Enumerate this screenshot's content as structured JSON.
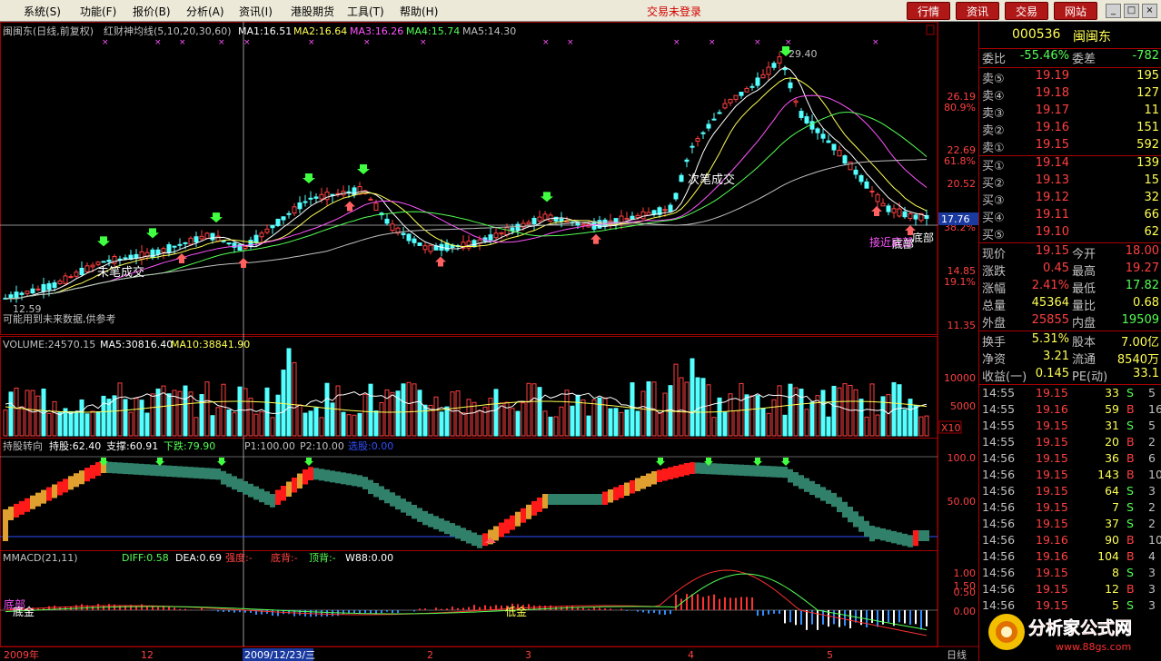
{
  "menu": [
    "系统(S)",
    "功能(F)",
    "报价(B)",
    "分析(A)",
    "资讯(I)",
    "港股期货",
    "工具(T)",
    "帮助(H)"
  ],
  "login_status": "交易未登录",
  "top_buttons": [
    "行情",
    "资讯",
    "交易",
    "网站"
  ],
  "window_buttons": [
    "_",
    "□",
    "×"
  ],
  "main_chart": {
    "title": "闽闽东(日线,前复权)",
    "indicator": "红财神均线(5,10,20,30,60)",
    "ma": [
      {
        "label": "MA1:16.51",
        "color": "#ffffff"
      },
      {
        "label": "MA2:16.64",
        "color": "#ffff54"
      },
      {
        "label": "MA3:16.26",
        "color": "#ff54ff"
      },
      {
        "label": "MA4:15.74",
        "color": "#54ff54"
      },
      {
        "label": "MA5:14.30",
        "color": "#c0c0c0"
      }
    ],
    "price_axis": [
      "26.19",
      "22.69",
      "20.52",
      "14.85",
      "11.35"
    ],
    "pct_axis": [
      "80.9%",
      "61.8%",
      "38.2%",
      "19.1%"
    ],
    "high_label": "29.40",
    "low_label": "12.59",
    "cursor_price": "17.76",
    "notes": [
      "未笔成交",
      "次笔成交",
      "可能用到未来数据,供参考",
      "接近底部",
      "底部",
      "底部"
    ]
  },
  "volume": {
    "title": "VOLUME:24570.15",
    "ma5": "MA5:30816.40",
    "ma10": "MA10:38841.90",
    "axis": [
      "10000",
      "5000"
    ],
    "unit": "X10"
  },
  "hold": {
    "title": "持股转向",
    "hold_val": "持股:62.40",
    "support": "支撑:60.91",
    "drop": "下跌:79.90",
    "p1": "P1:100.00",
    "p2": "P2:10.00",
    "sel": "选股:0.00",
    "axis": [
      "100.0",
      "50.00"
    ]
  },
  "macd": {
    "title": "MMACD(21,11)",
    "diff": "DIFF:0.58",
    "dea": "DEA:0.69",
    "strong": "强度:-",
    "bottom": "底背:-",
    "top": "顶背:-",
    "w88": "W88:0.00",
    "axis": [
      "1.50",
      "1.00",
      "0.50",
      "0.00"
    ],
    "tags": [
      "底部",
      "底金",
      "低金"
    ]
  },
  "date_axis": [
    "2009年",
    "12",
    "2009/12/23/三",
    "2",
    "3",
    "4",
    "5"
  ],
  "period": "日线",
  "stock": {
    "code": "000536",
    "name": "闽闽东"
  },
  "ratio": {
    "label1": "委比",
    "val1": "-55.46%",
    "label2": "委差",
    "val2": "-782"
  },
  "sells": [
    {
      "label": "卖⑤",
      "price": "19.19",
      "vol": "195"
    },
    {
      "label": "卖④",
      "price": "19.18",
      "vol": "127"
    },
    {
      "label": "卖③",
      "price": "19.17",
      "vol": "11"
    },
    {
      "label": "卖②",
      "price": "19.16",
      "vol": "151"
    },
    {
      "label": "卖①",
      "price": "19.15",
      "vol": "592"
    }
  ],
  "buys": [
    {
      "label": "买①",
      "price": "19.14",
      "vol": "139"
    },
    {
      "label": "买②",
      "price": "19.13",
      "vol": "15"
    },
    {
      "label": "买③",
      "price": "19.12",
      "vol": "32"
    },
    {
      "label": "买④",
      "price": "19.11",
      "vol": "66"
    },
    {
      "label": "买⑤",
      "price": "19.10",
      "vol": "62"
    }
  ],
  "quote": [
    {
      "l1": "现价",
      "v1": "19.15",
      "l2": "今开",
      "v2": "18.00",
      "c1": "#ff4040",
      "c2": "#ff4040"
    },
    {
      "l1": "涨跌",
      "v1": "0.45",
      "l2": "最高",
      "v2": "19.27",
      "c1": "#ff4040",
      "c2": "#ff4040"
    },
    {
      "l1": "涨幅",
      "v1": "2.41%",
      "l2": "最低",
      "v2": "17.82",
      "c1": "#ff4040",
      "c2": "#54ff54"
    },
    {
      "l1": "总量",
      "v1": "45364",
      "l2": "量比",
      "v2": "0.68",
      "c1": "#ffff54",
      "c2": "#ffff54"
    },
    {
      "l1": "外盘",
      "v1": "25855",
      "l2": "内盘",
      "v2": "19509",
      "c1": "#ff4040",
      "c2": "#54ff54"
    }
  ],
  "fund": [
    {
      "l1": "换手",
      "v1": "5.31%",
      "l2": "股本",
      "v2": "7.00亿"
    },
    {
      "l1": "净资",
      "v1": "3.21",
      "l2": "流通",
      "v2": "8540万"
    },
    {
      "l1": "收益(一)",
      "v1": "0.145",
      "l2": "PE(动)",
      "v2": "33.1"
    }
  ],
  "ticks": [
    {
      "time": "14:55",
      "price": "19.15",
      "vol": "33",
      "side": "S",
      "n": "5"
    },
    {
      "time": "14:55",
      "price": "19.16",
      "vol": "59",
      "side": "B",
      "n": "16"
    },
    {
      "time": "14:55",
      "price": "19.15",
      "vol": "31",
      "side": "S",
      "n": "5"
    },
    {
      "time": "14:55",
      "price": "19.15",
      "vol": "20",
      "side": "B",
      "n": "2"
    },
    {
      "time": "14:56",
      "price": "19.15",
      "vol": "36",
      "side": "B",
      "n": "6"
    },
    {
      "time": "14:56",
      "price": "19.15",
      "vol": "143",
      "side": "B",
      "n": "10"
    },
    {
      "time": "14:56",
      "price": "19.15",
      "vol": "64",
      "side": "S",
      "n": "3"
    },
    {
      "time": "14:56",
      "price": "19.15",
      "vol": "7",
      "side": "S",
      "n": "2"
    },
    {
      "time": "14:56",
      "price": "19.15",
      "vol": "37",
      "side": "S",
      "n": "2"
    },
    {
      "time": "14:56",
      "price": "19.16",
      "vol": "90",
      "side": "B",
      "n": "10"
    },
    {
      "time": "14:56",
      "price": "19.16",
      "vol": "104",
      "side": "B",
      "n": "4"
    },
    {
      "time": "14:56",
      "price": "19.15",
      "vol": "8",
      "side": "S",
      "n": "3"
    },
    {
      "time": "14:56",
      "price": "19.15",
      "vol": "12",
      "side": "B",
      "n": "3"
    },
    {
      "time": "14:56",
      "price": "19.15",
      "vol": "5",
      "side": "S",
      "n": "3"
    }
  ],
  "watermark": {
    "text": "分析家公式网",
    "url": "www.88gs.com"
  },
  "colors": {
    "up": "#ff4040",
    "down": "#54ffff",
    "grid": "#a00000",
    "buy": "#54ff54",
    "sell": "#ff4040",
    "label": "#c0c0c0"
  }
}
